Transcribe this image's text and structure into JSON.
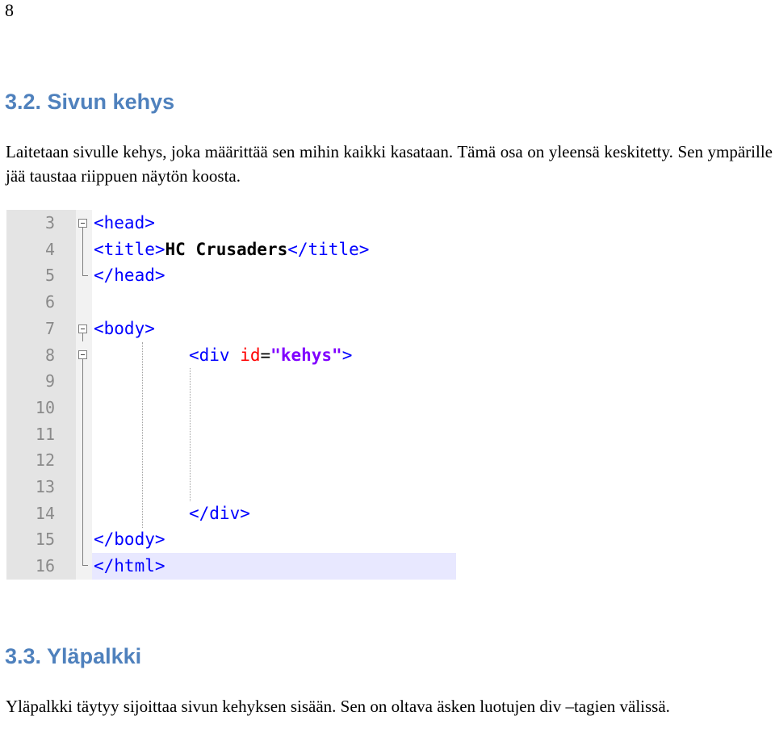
{
  "page_number": "8",
  "section1": {
    "heading": "3.2. Sivun kehys",
    "paragraph": "Laitetaan sivulle kehys, joka määrittää sen mihin kaikki kasataan. Tämä osa on yleensä keskitetty. Sen ympärille jää taustaa riippuen näytön koosta."
  },
  "code_screenshot": {
    "lines": [
      {
        "num": "3",
        "tokens": [
          {
            "t": "<head>",
            "c": "tag"
          }
        ]
      },
      {
        "num": "4",
        "tokens": [
          {
            "t": "<title>",
            "c": "tag"
          },
          {
            "t": "HC Crusaders",
            "c": "bold"
          },
          {
            "t": "</title>",
            "c": "tag"
          }
        ]
      },
      {
        "num": "5",
        "tokens": [
          {
            "t": "</head>",
            "c": "tag"
          }
        ]
      },
      {
        "num": "6",
        "tokens": []
      },
      {
        "num": "7",
        "tokens": [
          {
            "t": "<body>",
            "c": "tag"
          }
        ]
      },
      {
        "num": "8",
        "tokens": [
          {
            "t": "<div ",
            "c": "tag"
          },
          {
            "t": "id",
            "c": "attr"
          },
          {
            "t": "=",
            "c": "eq"
          },
          {
            "t": "\"kehys\"",
            "c": "str"
          },
          {
            "t": ">",
            "c": "tag"
          }
        ]
      },
      {
        "num": "9",
        "tokens": []
      },
      {
        "num": "10",
        "tokens": []
      },
      {
        "num": "11",
        "tokens": []
      },
      {
        "num": "12",
        "tokens": []
      },
      {
        "num": "13",
        "tokens": []
      },
      {
        "num": "14",
        "tokens": [
          {
            "t": "</div>",
            "c": "tag"
          }
        ]
      },
      {
        "num": "15",
        "tokens": [
          {
            "t": "</body>",
            "c": "tag"
          }
        ]
      },
      {
        "num": "16",
        "tokens": [
          {
            "t": "</html>",
            "c": "tag"
          }
        ]
      }
    ]
  },
  "section2": {
    "heading": "3.3. Yläpalkki",
    "paragraph": "Yläpalkki täytyy sijoittaa sivun kehyksen sisään. Sen on oltava äsken luotujen div –tagien välissä."
  }
}
